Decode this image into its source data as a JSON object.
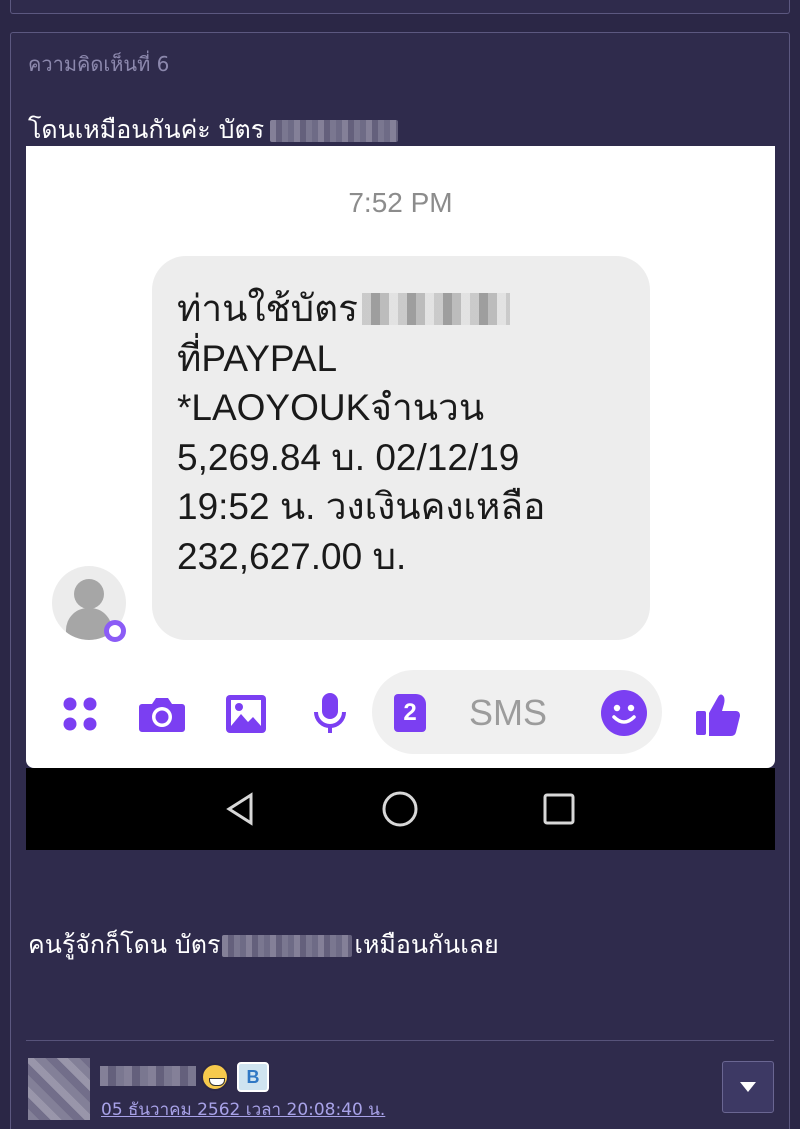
{
  "comment": {
    "number": "ความคิดเห็นที่ 6",
    "text_before": "โดนเหมือนกันค่ะ บัตร",
    "text_after_1": "คนรู้จักก็โดน บัตร",
    "text_after_2": "เหมือนกันเลย"
  },
  "screenshot": {
    "time": "7:52 PM",
    "message_lines": [
      "ท่านใช้บัตร",
      "ที่PAYPAL",
      "*LAOYOUKจำนวน",
      "5,269.84 บ. 02/12/19",
      "19:52 น. วงเงินคงเหลือ",
      "232,627.00 บ."
    ],
    "sms_placeholder": "SMS",
    "sim_badge": "2",
    "accent_color": "#7b3ff2",
    "toolbar_icons": [
      "apps-icon",
      "camera-icon",
      "image-icon",
      "microphone-icon",
      "sim-2-icon",
      "emoji-icon",
      "thumbs-up-icon"
    ],
    "nav_icons": [
      "back-icon",
      "home-icon",
      "recents-icon"
    ]
  },
  "footer": {
    "timestamp": "05 ธันวาคม 2562 เวลา 20:08:40 น.",
    "badge_label": "B",
    "menu_icon": "caret-down-icon"
  }
}
